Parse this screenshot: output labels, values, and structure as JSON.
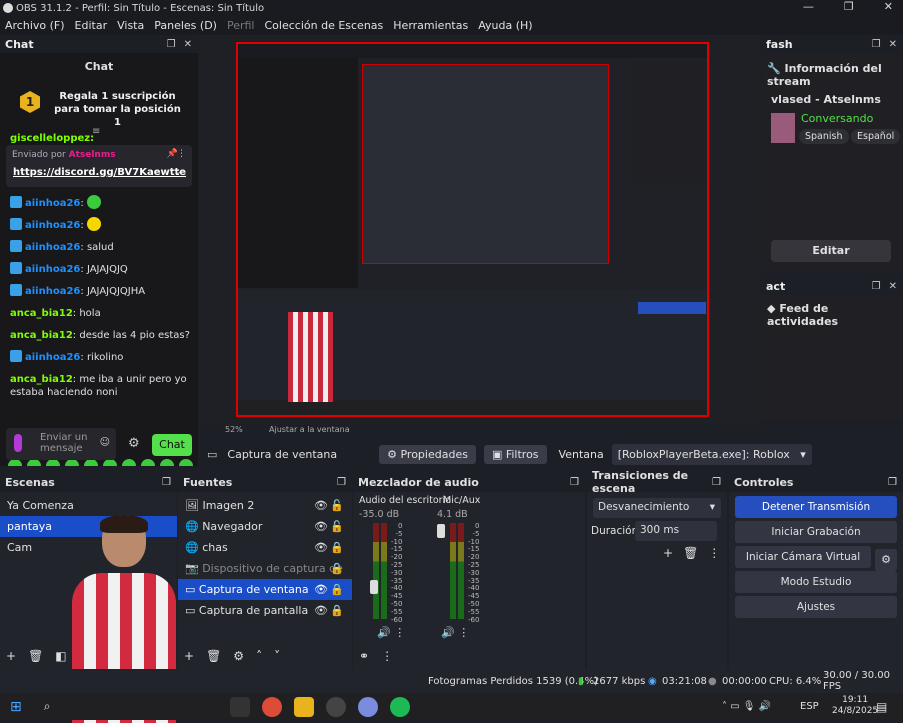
{
  "window": {
    "title": "OBS 31.1.2 - Perfil: Sin Título - Escenas: Sin Título",
    "min": "—",
    "max": "❐",
    "close": "✕"
  },
  "menu": [
    "Archivo (F)",
    "Editar",
    "Vista",
    "Paneles (D)",
    "Perfil",
    "Colección de Escenas",
    "Herramientas",
    "Ayuda (H)"
  ],
  "chat": {
    "dock_title": "Chat",
    "title": "Chat",
    "sub_badge": "1",
    "sub_text": "Regala 1 suscripción para tomar la posición 1",
    "pinned_by_label": "Enviado por",
    "pinned_by_user": "Atselnms",
    "pinned_link": "https://discord.gg/BV7Kaewtte",
    "partial_top": "giscelleloppez:",
    "messages": [
      {
        "user": "aiinhoa26",
        "text": ":",
        "emote": true
      },
      {
        "user": "aiinhoa26",
        "text": ":",
        "emote": true
      },
      {
        "user": "aiinhoa26",
        "text": ": salud"
      },
      {
        "user": "aiinhoa26",
        "text": ": JAJAJQJQ"
      },
      {
        "user": "aiinhoa26",
        "text": ": JAJAJQJQJHA"
      },
      {
        "user": "anca_bia12",
        "text": ": hola"
      },
      {
        "user": "anca_bia12",
        "text": ": desde las 4 pio estas?"
      },
      {
        "user": "aiinhoa26",
        "text": ": rikolino"
      },
      {
        "user": "anca_bia12",
        "text": ": me iba a unir pero yo"
      },
      {
        "user": "",
        "text": "estaba haciendo noni"
      }
    ],
    "input_placeholder": "Enviar un mensaje",
    "send": "Chat"
  },
  "preview": {
    "zoom": "52%",
    "fit": "Ajustar a la ventana"
  },
  "right": {
    "dock_title": "fash",
    "info_title": "Información del stream",
    "streamer": "vlased - Atselnms",
    "category": "Conversando",
    "tags": [
      "Spanish",
      "Español"
    ],
    "edit": "Editar",
    "act_title": "act",
    "feed": "Feed de actividades"
  },
  "source_bar": {
    "name": "Captura de ventana",
    "props": "Propiedades",
    "filters": "Filtros",
    "window_label": "Ventana",
    "window_value": "[RobloxPlayerBeta.exe]: Roblox"
  },
  "scenes": {
    "title": "Escenas",
    "items": [
      "Ya Comenza",
      "pantaya",
      "Cam"
    ],
    "selected": 1
  },
  "sources": {
    "title": "Fuentes",
    "items": [
      "Imagen 2",
      "Navegador",
      "chas",
      "Dispositivo de captura de",
      "Captura de ventana",
      "Captura de pantalla"
    ],
    "selected": 4
  },
  "mixer": {
    "title": "Mezclador de audio",
    "ch1": "Audio del escritorio",
    "ch1_db": "-35.0 dB",
    "ch2": "Mic/Aux",
    "ch2_db": "4.1 dB",
    "scale": [
      "0",
      "-5",
      "-10",
      "-15",
      "-20",
      "-25",
      "-30",
      "-35",
      "-40",
      "-45",
      "-50",
      "-55",
      "-60"
    ]
  },
  "transitions": {
    "title": "Transiciones de escena",
    "type": "Desvanecimiento",
    "duration_label": "Duración",
    "duration": "300 ms"
  },
  "controls": {
    "title": "Controles",
    "buttons": [
      "Detener Transmisión",
      "Iniciar Grabación",
      "Iniciar Cámara Virtual",
      "Modo Estudio",
      "Ajustes"
    ]
  },
  "status": {
    "dropped": "Fotogramas Perdidos 1539 (0.4%)",
    "bitrate": "2677 kbps",
    "stream_time": "03:21:08",
    "rec_time": "00:00:00",
    "cpu": "CPU: 6.4%",
    "fps": "30.00 / 30.00 FPS"
  },
  "taskbar": {
    "lang": "ESP",
    "time": "19:11",
    "date": "24/8/2025"
  },
  "colors": {
    "accent": "#254ebf",
    "twitch_green": "#53e04a",
    "selection": "#1a4dc8"
  }
}
